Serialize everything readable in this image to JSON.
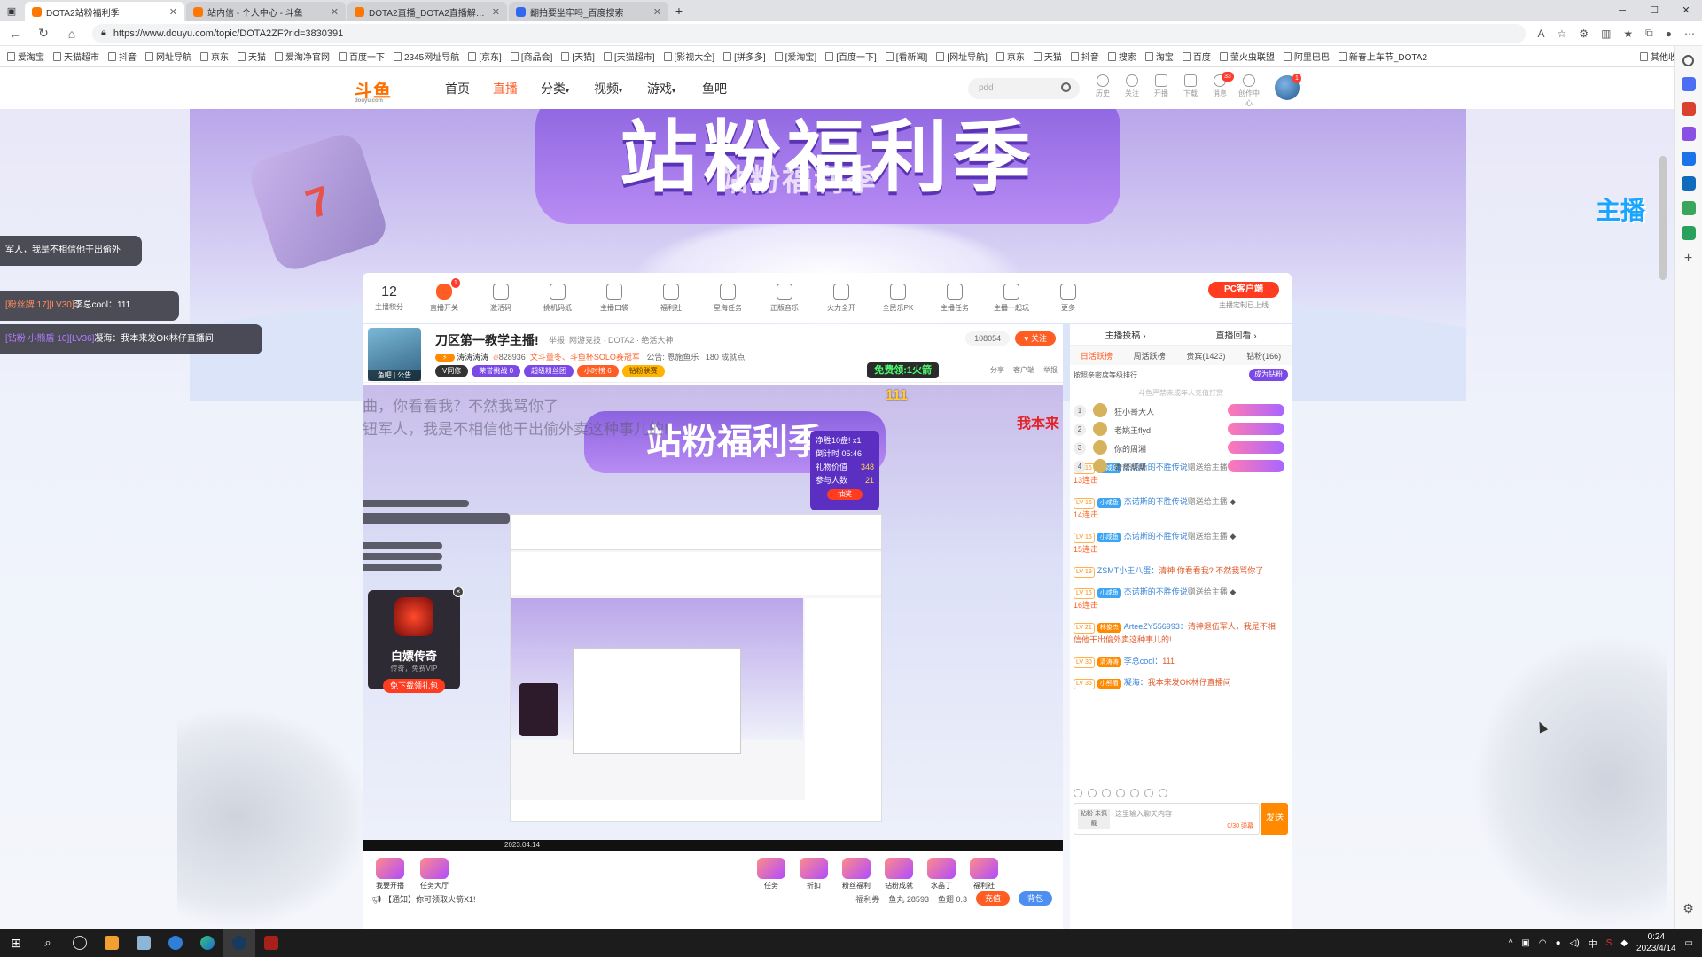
{
  "browser": {
    "tabs": [
      {
        "title": "DOTA2站粉福利季",
        "active": true
      },
      {
        "title": "站内信 - 个人中心 - 斗鱼",
        "active": false
      },
      {
        "title": "DOTA2直播_DOTA2直播解说视频",
        "active": false
      },
      {
        "title": "翻拍要坐牢吗_百度搜索",
        "active": false
      }
    ],
    "url": "https://www.douyu.com/topic/DOTA2ZF?rid=3830391",
    "bookmarks": [
      "爱淘宝",
      "天猫超市",
      "抖音",
      "网址导航",
      "京东",
      "天猫",
      "爱淘净官网",
      "百度一下",
      "2345网址导航",
      "[京东]",
      "[商品会]",
      "[天猫]",
      "[天猫超市]",
      "[影视大全]",
      "[拼多多]",
      "[爱淘宝]",
      "[百度一下]",
      "[看新闻]",
      "[网址导航]",
      "京东",
      "天猫",
      "抖音",
      "搜索",
      "淘宝",
      "百度",
      "萤火虫联盟",
      "阿里巴巴",
      "新春上车节_DOTA2"
    ],
    "bookmarks_other": "其他收藏夹"
  },
  "site": {
    "logo": "斗鱼",
    "logo_sub": "douyu.com",
    "nav": [
      "首页",
      "直播",
      "分类",
      "视频",
      "游戏",
      "鱼吧"
    ],
    "nav_active": "直播",
    "search_placeholder": "pdd",
    "header_icons": [
      "历史",
      "关注",
      "开播",
      "下载",
      "消息",
      "创作中心"
    ],
    "msg_badge": "33",
    "avatar_badge": "1"
  },
  "banner": {
    "title": "站粉福利季",
    "overlay": "站粉福利季",
    "dice_text": "7"
  },
  "danmaku": [
    {
      "prefix": "",
      "name": "",
      "text": "军人，我是不相信他干出偷外"
    },
    {
      "prefix": "[粉丝牌 17][LV30]",
      "name": "李总cool：",
      "text": "111"
    },
    {
      "prefix": "[钻粉 小熊盾 10][LV36]",
      "name": "凝海：",
      "text": "我本来发OK林仔直播间"
    }
  ],
  "toolbar": {
    "score": "12",
    "score_label": "主播积分",
    "items": [
      "直播开关",
      "激活码",
      "挑机码纸",
      "主播口袋",
      "福利社",
      "星海任务",
      "正版音乐",
      "火力全开",
      "全民乐PK",
      "主播任务",
      "主播一起玩",
      "更多"
    ],
    "switch_badge": "1",
    "pc_btn": "PC客户端",
    "pc_sub": "主播定制已上线"
  },
  "anchor": {
    "title": "刀区第一教学主播!",
    "report": "举报",
    "category": "网游竞技 · DOTA2 · 绝活大神",
    "name": "涛涛涛涛",
    "hot": "828936",
    "tag": "文斗量冬、斗鱼杯SOLO赛冠军",
    "notice": "公告: 恩施鱼乐",
    "achievements": "180 成就点",
    "follow_count": "108054",
    "follow_label": "关注",
    "pills": [
      "V同修",
      "荣誉挑战 0",
      "超级粉丝团",
      "小时榜 6",
      "钻粉联赛"
    ],
    "free_btn": "免费领:1火箭",
    "actions": [
      "分享",
      "客户端",
      "举报"
    ],
    "sub_labels": [
      "鱼吧",
      "公告"
    ]
  },
  "video": {
    "overlay1": "曲，你看看我？不然我骂你了",
    "overlay2": "钮军人，我是不相信他干出偷外卖这种事儿的!",
    "num": "111",
    "wobe": "我本来",
    "lottery": {
      "title": "净胜10盘! x1",
      "countdown": "倒计时 05:46",
      "gift_label": "礼物价值",
      "gift_value": "348",
      "people_label": "参与人数",
      "people_value": "21",
      "btn": "抽奖"
    },
    "game": {
      "title": "白嫖传奇",
      "sub": "传奇，免费VIP",
      "btn": "免下载领礼包",
      "close": "×"
    },
    "status": "2023.04.14"
  },
  "bottom": {
    "gifts_left": [
      "我要开播",
      "任务大厅"
    ],
    "gifts_right": [
      "任务",
      "折扣",
      "粉丝福利",
      "钻粉成就",
      "水晶丁",
      "福利社"
    ],
    "notice": "【通知】你可领取火箭X1!",
    "fish_info": "鱼丸 28593",
    "fish_bar": "鱼翅 0.3",
    "welfare": "福利券",
    "charge": "充值",
    "bag": "背包"
  },
  "chat": {
    "top": [
      "主播投稿",
      "直播回看"
    ],
    "tabs": [
      "日活跃榜",
      "周活跃榜",
      "贵宾(1423)",
      "钻粉(166)"
    ],
    "tab_active": "日活跃榜",
    "rank_title": "按照亲密度等级排行",
    "rank_btn": "成为钻粉",
    "rank_hint": "斗鱼严禁未成年人充值打赏",
    "ranks": [
      {
        "no": "1",
        "name": "狂小哥大人"
      },
      {
        "no": "2",
        "name": "老姚王flyd"
      },
      {
        "no": "3",
        "name": "你的周湘"
      },
      {
        "no": "4",
        "name": "索帮帮帮"
      }
    ],
    "messages": [
      {
        "lv": "LV 16",
        "fan": "小咸鱼",
        "user": "杰诺斯的不胜传说",
        "gift": "赠送给主播",
        "combo": "13连击",
        "text": ""
      },
      {
        "lv": "LV 16",
        "fan": "小咸鱼",
        "user": "杰诺斯的不胜传说",
        "gift": "赠送给主播",
        "combo": "14连击",
        "text": ""
      },
      {
        "lv": "LV 16",
        "fan": "小咸鱼",
        "user": "杰诺斯的不胜传说",
        "gift": "赠送给主播",
        "combo": "15连击",
        "text": ""
      },
      {
        "lv": "LV 19",
        "fan": "",
        "user": "ZSMT小王八蛋：",
        "gift": "",
        "combo": "",
        "text": "清神 你看看我? 不然我骂你了"
      },
      {
        "lv": "LV 16",
        "fan": "小咸鱼",
        "user": "杰诺斯的不胜传说",
        "gift": "赠送给主播",
        "combo": "16连击",
        "text": ""
      },
      {
        "lv": "LV 21",
        "fan": "林俊杰",
        "user": "ArteeZY556993：",
        "gift": "",
        "combo": "",
        "text": "清神退伍军人，我是不相信他干出偷外卖这种事儿的!"
      },
      {
        "lv": "LV 30",
        "fan": "清涛涛",
        "user": "李总cool：",
        "gift": "",
        "combo": "",
        "text": "111"
      },
      {
        "lv": "LV 36",
        "fan": "小熊盾",
        "user": "凝海：",
        "gift": "",
        "combo": "",
        "text": "我本来发OK林仔直播间"
      }
    ],
    "input_level": "钻粉 未佩戴",
    "input_placeholder": "这里输入聊天内容",
    "input_hint": "0/30 弹幕",
    "send": "发送"
  },
  "float_logo": "主播",
  "taskbar": {
    "time": "0:24",
    "date": "2023/4/14",
    "ime": "中"
  }
}
